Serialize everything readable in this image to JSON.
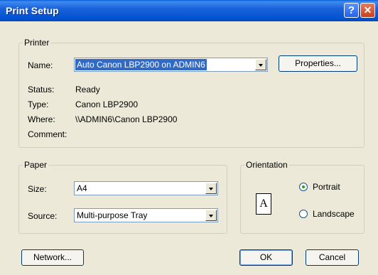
{
  "window": {
    "title": "Print Setup",
    "help_glyph": "?",
    "close_glyph": "✕"
  },
  "printer": {
    "group_label": "Printer",
    "name_label": "Name:",
    "name_value": "Auto Canon LBP2900 on ADMIN6",
    "properties_label": "Properties...",
    "status_label": "Status:",
    "status_value": "Ready",
    "type_label": "Type:",
    "type_value": "Canon LBP2900",
    "where_label": "Where:",
    "where_value": "\\\\ADMIN6\\Canon LBP2900",
    "comment_label": "Comment:",
    "comment_value": ""
  },
  "paper": {
    "group_label": "Paper",
    "size_label": "Size:",
    "size_value": "A4",
    "source_label": "Source:",
    "source_value": "Multi-purpose Tray"
  },
  "orientation": {
    "group_label": "Orientation",
    "icon_letter": "A",
    "portrait_label": "Portrait",
    "landscape_label": "Landscape",
    "selected": "Portrait"
  },
  "buttons": {
    "network": "Network...",
    "ok": "OK",
    "cancel": "Cancel"
  },
  "colors": {
    "titlebar": "#0052d1",
    "face": "#ece9d8",
    "selection": "#316ac5"
  }
}
